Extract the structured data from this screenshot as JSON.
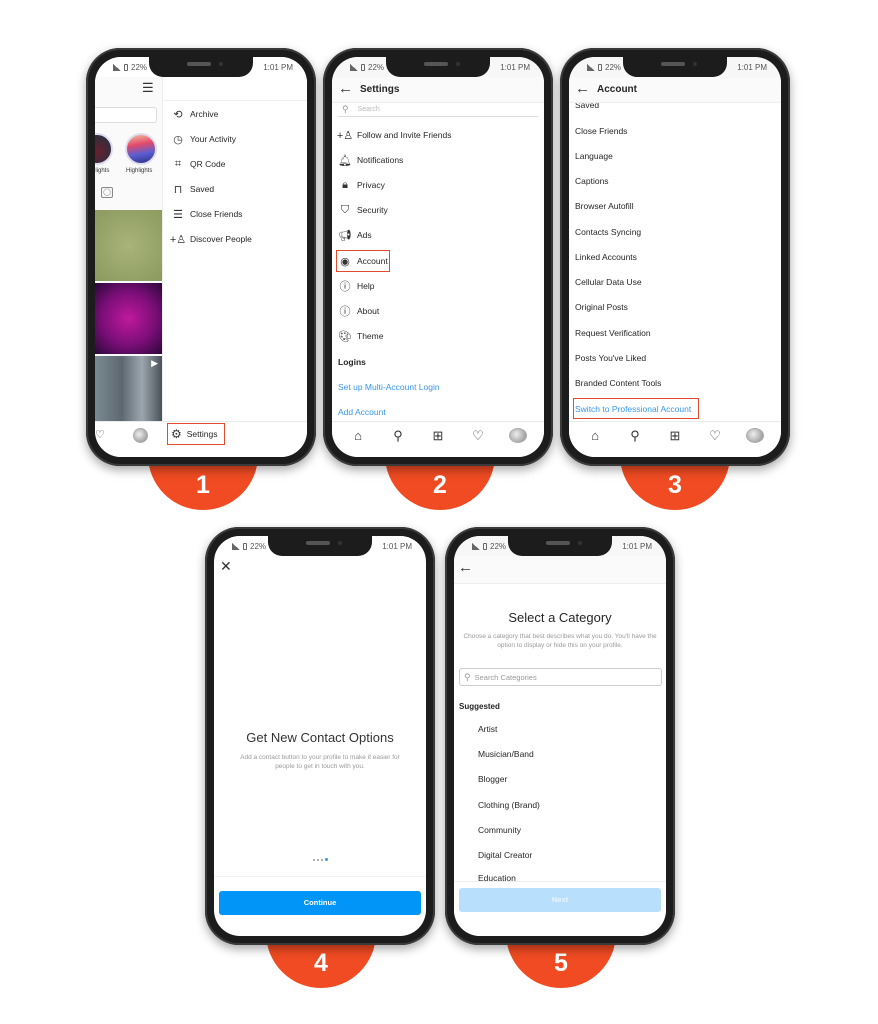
{
  "status_bar": {
    "signal": "signal-icon",
    "battery_percent": "22%",
    "time": "1:01 PM"
  },
  "badges": [
    "1",
    "2",
    "3",
    "4",
    "5"
  ],
  "accent_colors": {
    "badge": "#f04b22",
    "highlight_box": "#e24b2c",
    "link_blue": "#3897f0",
    "button_blue": "#0095f6",
    "button_disabled": "#b8dffc"
  },
  "step1": {
    "highlights": [
      "Highlights",
      "Highlights"
    ],
    "menu_items": [
      {
        "icon": "archive-icon",
        "label": "Archive"
      },
      {
        "icon": "activity-icon",
        "label": "Your Activity"
      },
      {
        "icon": "qr-code-icon",
        "label": "QR Code"
      },
      {
        "icon": "bookmark-icon",
        "label": "Saved"
      },
      {
        "icon": "close-friends-icon",
        "label": "Close Friends"
      },
      {
        "icon": "add-person-icon",
        "label": "Discover People"
      }
    ],
    "settings_label": "Settings"
  },
  "step2": {
    "title": "Settings",
    "search_placeholder": "Search",
    "items": [
      {
        "icon": "add-person-icon",
        "label": "Follow and Invite Friends"
      },
      {
        "icon": "bell-icon",
        "label": "Notifications"
      },
      {
        "icon": "lock-icon",
        "label": "Privacy"
      },
      {
        "icon": "shield-icon",
        "label": "Security"
      },
      {
        "icon": "megaphone-icon",
        "label": "Ads"
      },
      {
        "icon": "account-icon",
        "label": "Account"
      },
      {
        "icon": "help-icon",
        "label": "Help"
      },
      {
        "icon": "info-icon",
        "label": "About"
      },
      {
        "icon": "palette-icon",
        "label": "Theme"
      }
    ],
    "logins_header": "Logins",
    "multi_account_link": "Set up Multi-Account Login",
    "add_account_link": "Add Account"
  },
  "step3": {
    "title": "Account",
    "partial_top": "Saved",
    "items": [
      "Close Friends",
      "Language",
      "Captions",
      "Browser Autofill",
      "Contacts Syncing",
      "Linked Accounts",
      "Cellular Data Use",
      "Original Posts",
      "Request Verification",
      "Posts You've Liked",
      "Branded Content Tools"
    ],
    "switch_link": "Switch to Professional Account"
  },
  "step4": {
    "title": "Get New Contact Options",
    "description": "Add a contact button to your profile to make it easier for people to get in touch with you.",
    "page_indicator": {
      "total": 4,
      "active": 4
    },
    "continue_label": "Continue"
  },
  "step5": {
    "title": "Select a Category",
    "description": "Choose a category that best describes what you do. You'll have the option to display or hide this on your profile.",
    "search_placeholder": "Search Categories",
    "suggested_header": "Suggested",
    "categories": [
      "Artist",
      "Musician/Band",
      "Blogger",
      "Clothing (Brand)",
      "Community",
      "Digital Creator",
      "Education"
    ],
    "next_label": "Next"
  }
}
